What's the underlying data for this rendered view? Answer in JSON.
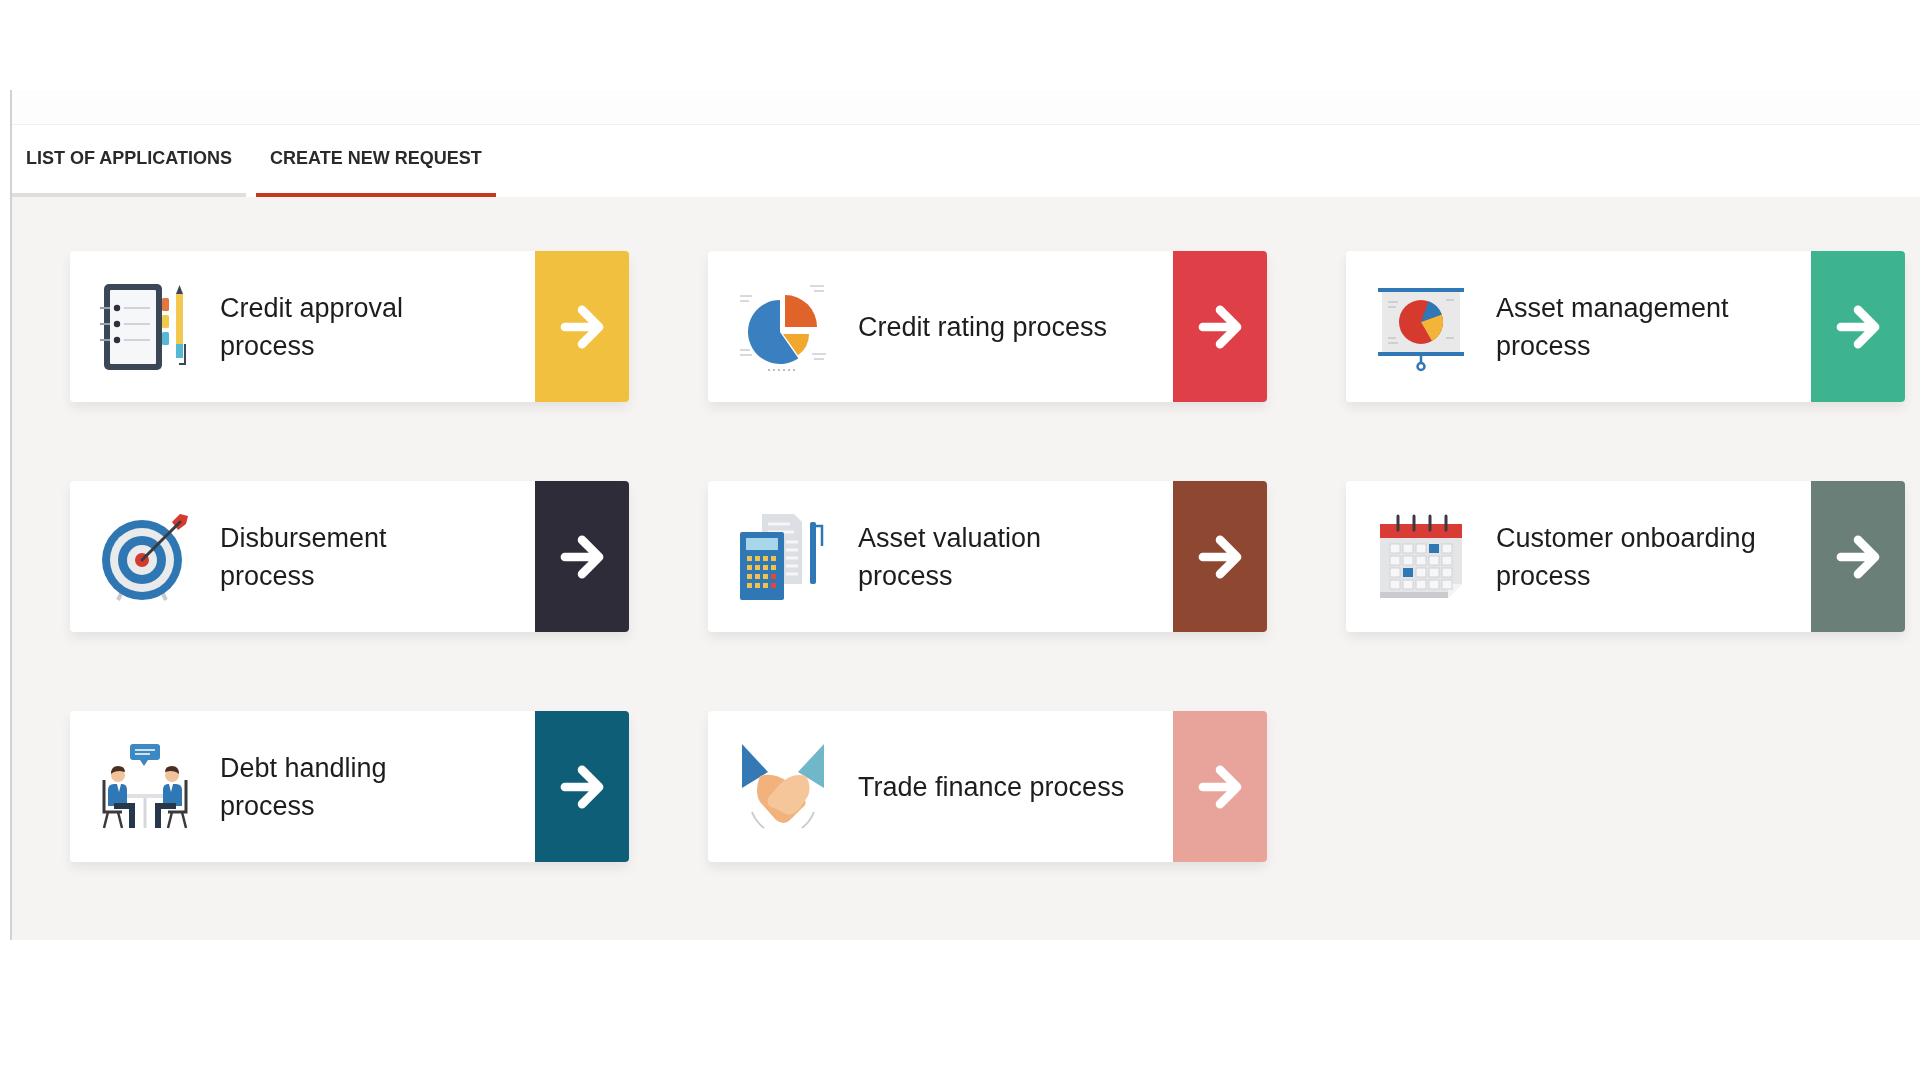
{
  "tabs": [
    {
      "label": "LIST OF APPLICATIONS",
      "selected": false
    },
    {
      "label": "CREATE NEW REQUEST",
      "selected": true
    }
  ],
  "processes": [
    {
      "label": "Credit approval\nprocess",
      "kind": "checklist",
      "color": "#f0c03e"
    },
    {
      "label": "Credit rating process",
      "kind": "pie-chart",
      "color": "#df3f46"
    },
    {
      "label": "Asset management\nprocess",
      "kind": "presentation",
      "color": "#3db48f"
    },
    {
      "label": "Disbursement\nprocess",
      "kind": "target",
      "color": "#2d2c38"
    },
    {
      "label": "Asset valuation\nprocess",
      "kind": "calculator",
      "color": "#8e4731"
    },
    {
      "label": "Customer onboarding\nprocess",
      "kind": "calendar",
      "color": "#6a7f77"
    },
    {
      "label": "Debt handling\nprocess",
      "kind": "meeting",
      "color": "#0e5e78"
    },
    {
      "label": "Trade finance process",
      "kind": "handshake",
      "color": "#e8a49a"
    }
  ]
}
